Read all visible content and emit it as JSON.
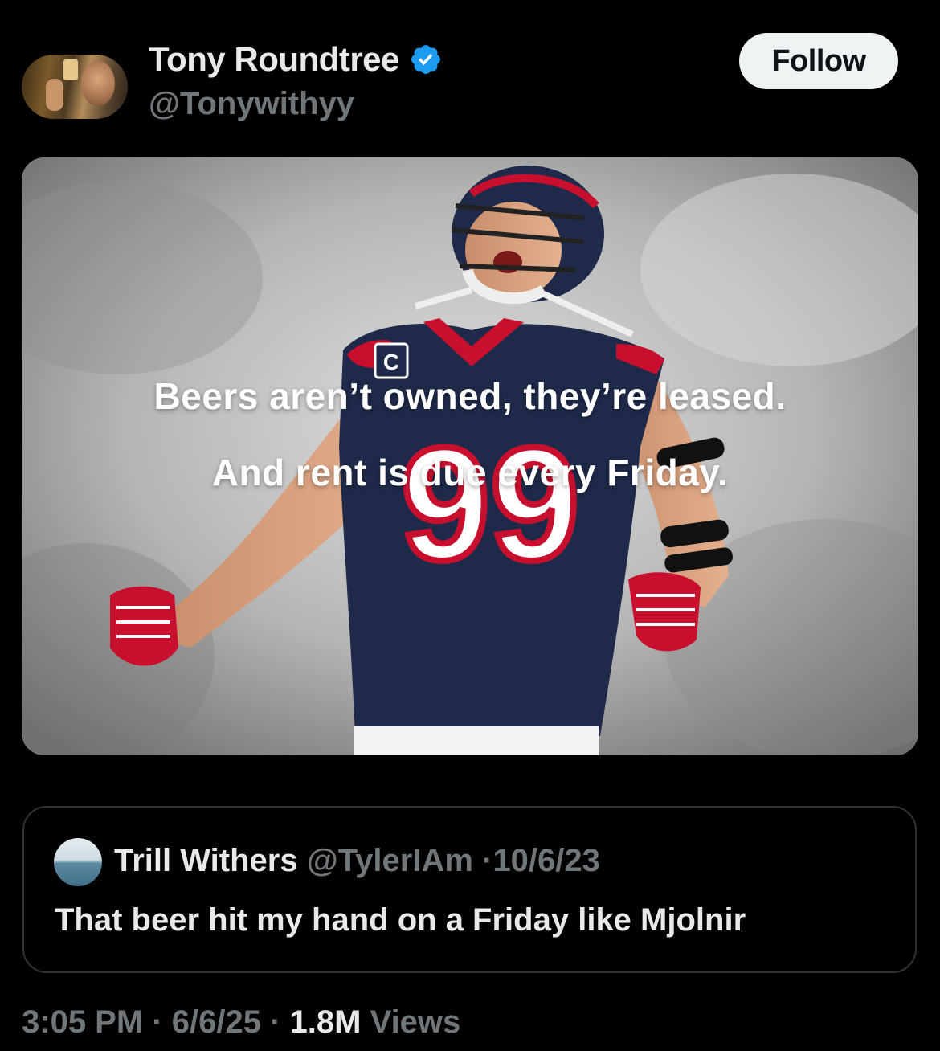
{
  "author": {
    "display_name": "Tony Roundtree",
    "handle": "@Tonywithyy",
    "verified": true,
    "verified_color": "#1d9bf0"
  },
  "follow_button": {
    "label": "Follow"
  },
  "media": {
    "overlay_line_1": "Beers aren’t owned, they’re leased.",
    "overlay_line_2": "And rent is due every Friday."
  },
  "quoted_post": {
    "display_name": "Trill Withers",
    "handle": "@TylerIAm",
    "separator": "·",
    "date": "10/6/23",
    "text": "That beer hit my hand on a Friday like Mjolnir"
  },
  "footer": {
    "time": "3:05 PM",
    "separator_1": "·",
    "date": "6/6/25",
    "separator_2": "·",
    "views_count": "1.8M",
    "views_label": "Views"
  },
  "colors": {
    "background": "#000000",
    "text_primary": "#e7e9ea",
    "text_secondary": "#71767b",
    "border": "#2f3336",
    "jersey_navy": "#1f2a4a",
    "jersey_red": "#c8102e"
  }
}
